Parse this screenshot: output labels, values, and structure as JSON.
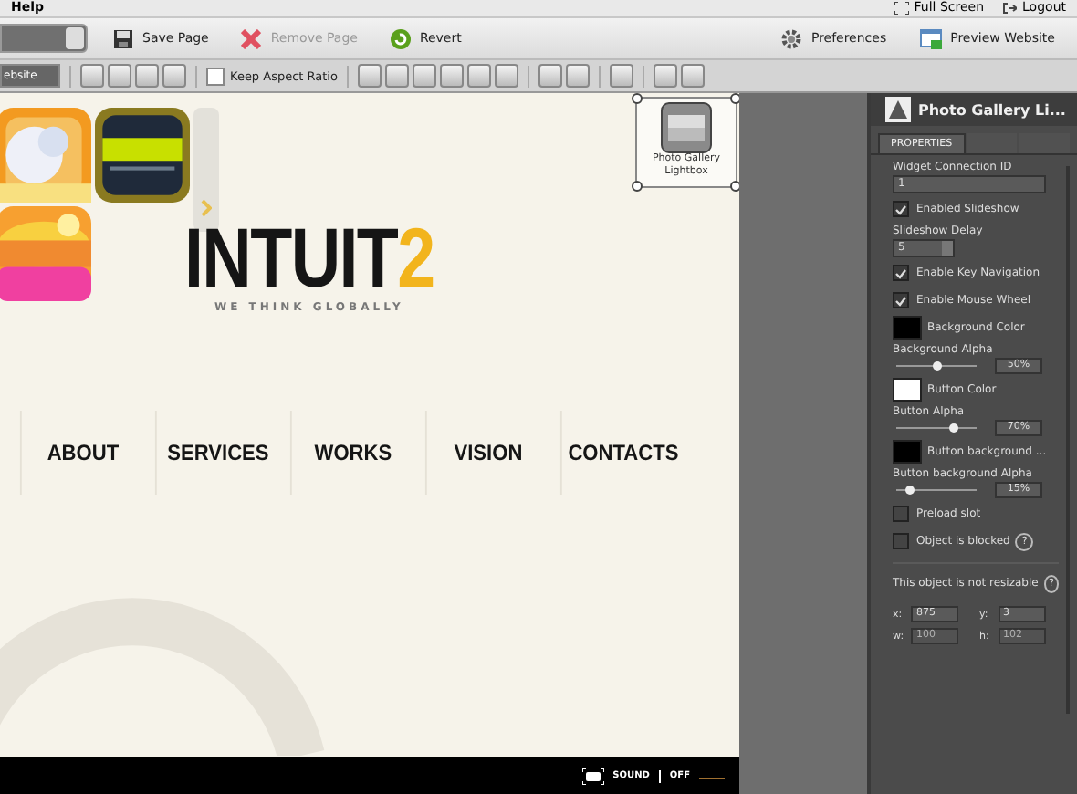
{
  "menu": {
    "left": [
      "Help"
    ],
    "right": [
      {
        "kind": "fullscreen",
        "label": "Full Screen"
      },
      {
        "kind": "logout",
        "label": "Logout"
      }
    ]
  },
  "toolbar": {
    "buttons": [
      {
        "kind": "save",
        "label": "Save Page",
        "disabled": false
      },
      {
        "kind": "remove",
        "label": "Remove Page",
        "disabled": true
      },
      {
        "kind": "revert",
        "label": "Revert",
        "disabled": false
      }
    ],
    "right": [
      {
        "kind": "gear",
        "label": "Preferences"
      },
      {
        "kind": "preview",
        "label": "Preview Website"
      }
    ]
  },
  "toolbar2": {
    "dropdown": "ebsite",
    "keep_aspect_ratio": {
      "label": "Keep Aspect Ratio",
      "checked": false
    }
  },
  "canvas": {
    "widget": {
      "label": "Photo Gallery Lightbox",
      "selected": true
    },
    "logo": {
      "text": "INTUIT",
      "accent": "2",
      "tagline": "WE THINK GLOBALLY"
    },
    "nav": [
      "ABOUT",
      "SERVICES",
      "WORKS",
      "VISION",
      "CONTACTS"
    ],
    "footer": {
      "sound": "SOUND",
      "state": "OFF"
    }
  },
  "panel": {
    "title": "Photo Gallery Li...",
    "tabs": [
      {
        "label": "PROPERTIES",
        "selected": true
      }
    ],
    "rows": [
      {
        "kind": "field",
        "label": "Widget Connection ID",
        "value": "1"
      },
      {
        "kind": "checkbox",
        "label": "Enabled Slideshow",
        "checked": true
      },
      {
        "kind": "spinner",
        "label": "Slideshow Delay",
        "value": "5"
      },
      {
        "kind": "checkbox",
        "label": "Enable Key Navigation",
        "checked": true
      },
      {
        "kind": "checkbox",
        "label": "Enable Mouse Wheel",
        "checked": true
      },
      {
        "kind": "color",
        "label": "Background Color",
        "color": "#000000"
      },
      {
        "kind": "slider",
        "label": "Background Alpha",
        "level": 0.5,
        "reading": "50%"
      },
      {
        "kind": "color",
        "label": "Button Color",
        "color": "#ffffff"
      },
      {
        "kind": "slider",
        "label": "Button Alpha",
        "level": 0.7,
        "reading": "70%"
      },
      {
        "kind": "color",
        "label": "Button background ...",
        "color": "#000000"
      },
      {
        "kind": "slider",
        "label": "Button background Alpha",
        "level": 0.15,
        "reading": "15%"
      },
      {
        "kind": "checkbox",
        "label": "Preload slot",
        "checked": false
      },
      {
        "kind": "checkbox",
        "label": "Object is blocked",
        "checked": false,
        "help": "?"
      },
      {
        "kind": "note",
        "label": "This object is not resizable",
        "help": "?"
      }
    ],
    "coords": [
      {
        "label": "x:",
        "value": "875",
        "disabled": false
      },
      {
        "label": "y:",
        "value": "3",
        "disabled": false
      },
      {
        "label": "w:",
        "value": "100",
        "disabled": true
      },
      {
        "label": "h:",
        "value": "102",
        "disabled": true
      }
    ]
  }
}
